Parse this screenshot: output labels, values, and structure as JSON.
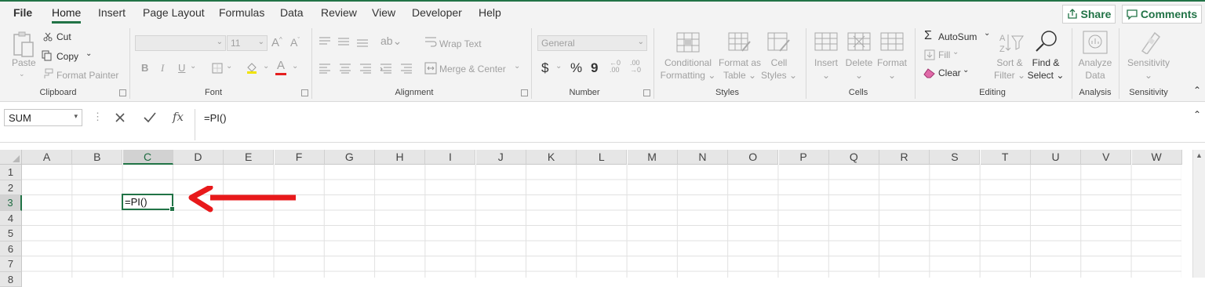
{
  "menu": {
    "tabs": [
      "File",
      "Home",
      "Insert",
      "Page Layout",
      "Formulas",
      "Data",
      "Review",
      "View",
      "Developer",
      "Help"
    ],
    "active_tab": "Home",
    "share_label": "Share",
    "comments_label": "Comments"
  },
  "ribbon": {
    "clipboard": {
      "paste": "Paste",
      "cut": "Cut",
      "copy": "Copy",
      "format_painter": "Format Painter",
      "label": "Clipboard"
    },
    "font": {
      "font_size": "11",
      "bold": "B",
      "italic": "I",
      "underline": "U",
      "label": "Font"
    },
    "alignment": {
      "wrap_text": "Wrap Text",
      "merge_center": "Merge & Center",
      "label": "Alignment"
    },
    "number": {
      "format": "General",
      "currency": "$",
      "percent": "%",
      "comma": "9",
      "label": "Number"
    },
    "styles": {
      "conditional_1": "Conditional",
      "conditional_2": "Formatting",
      "format_table_1": "Format as",
      "format_table_2": "Table",
      "cell_styles_1": "Cell",
      "cell_styles_2": "Styles",
      "label": "Styles"
    },
    "cells": {
      "insert": "Insert",
      "delete": "Delete",
      "format": "Format",
      "label": "Cells"
    },
    "editing": {
      "autosum": "AutoSum",
      "fill": "Fill",
      "clear": "Clear",
      "sort_1": "Sort &",
      "sort_2": "Filter",
      "find_1": "Find &",
      "find_2": "Select",
      "label": "Editing"
    },
    "analysis": {
      "analyze_1": "Analyze",
      "analyze_2": "Data",
      "label": "Analysis"
    },
    "sensitivity": {
      "button": "Sensitivity",
      "label": "Sensitivity"
    }
  },
  "formula_bar": {
    "name_box": "SUM",
    "fx": "fx",
    "formula": "=PI()"
  },
  "sheet": {
    "columns": [
      "A",
      "B",
      "C",
      "D",
      "E",
      "F",
      "G",
      "H",
      "I",
      "J",
      "K",
      "L",
      "M",
      "N",
      "O",
      "P",
      "Q",
      "R",
      "S",
      "T",
      "U",
      "V",
      "W"
    ],
    "rows": [
      "1",
      "2",
      "3",
      "4",
      "5",
      "6",
      "7",
      "8"
    ],
    "selected_column": "C",
    "selected_row": "3",
    "active_cell_value": "=PI()"
  },
  "colors": {
    "accent": "#217346",
    "arrow": "#e8191b"
  }
}
